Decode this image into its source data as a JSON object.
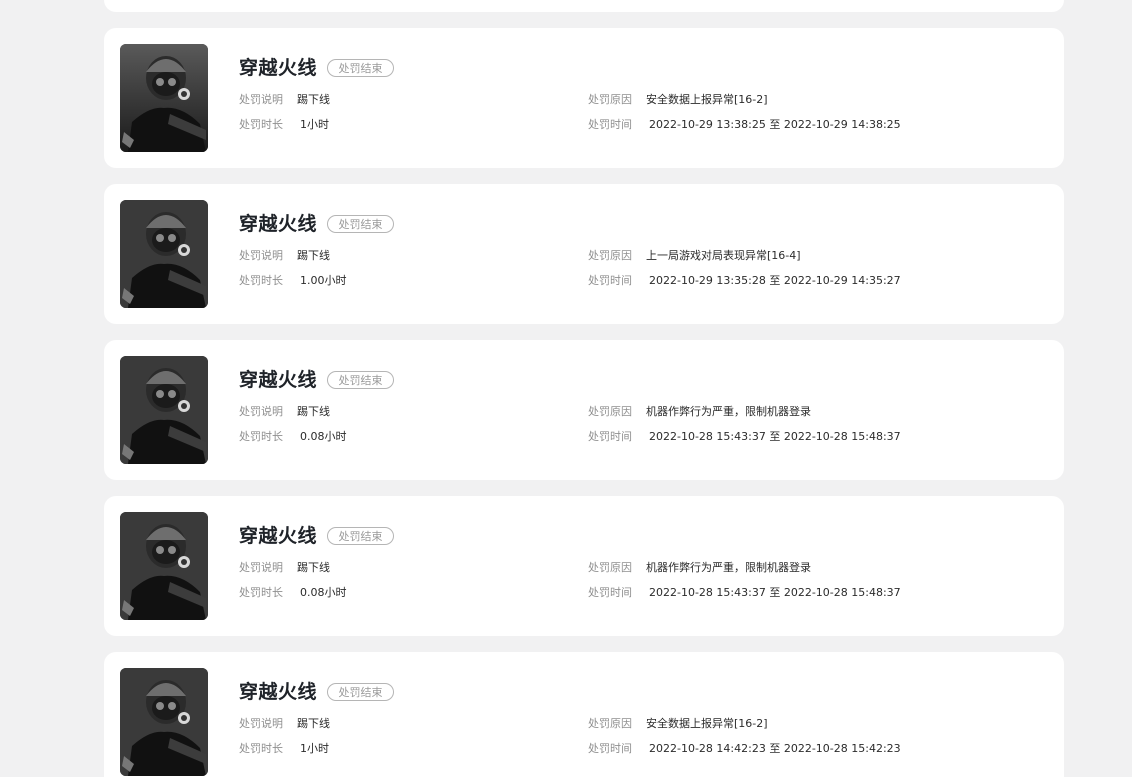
{
  "labels": {
    "desc": "处罚说明",
    "reason": "处罚原因",
    "duration": "处罚时长",
    "time": "处罚时间",
    "status": "处罚结束"
  },
  "records": [
    {
      "game": "穿越火线",
      "status": "处罚结束",
      "desc": "踢下线",
      "reason": "安全数据上报异常[16-2]",
      "duration": "1小时",
      "time": "2022-10-29 13:38:25 至 2022-10-29 14:38:25"
    },
    {
      "game": "穿越火线",
      "status": "处罚结束",
      "desc": "踢下线",
      "reason": "上一局游戏对局表现异常[16-4]",
      "duration": "1.00小时",
      "time": "2022-10-29 13:35:28 至 2022-10-29 14:35:27"
    },
    {
      "game": "穿越火线",
      "status": "处罚结束",
      "desc": "踢下线",
      "reason": "机器作弊行为严重，限制机器登录",
      "duration": "0.08小时",
      "time": "2022-10-28 15:43:37 至 2022-10-28 15:48:37"
    },
    {
      "game": "穿越火线",
      "status": "处罚结束",
      "desc": "踢下线",
      "reason": "机器作弊行为严重，限制机器登录",
      "duration": "0.08小时",
      "time": "2022-10-28 15:43:37 至 2022-10-28 15:48:37"
    },
    {
      "game": "穿越火线",
      "status": "处罚结束",
      "desc": "踢下线",
      "reason": "安全数据上报异常[16-2]",
      "duration": "1小时",
      "time": "2022-10-28 14:42:23 至 2022-10-28 15:42:23"
    }
  ]
}
